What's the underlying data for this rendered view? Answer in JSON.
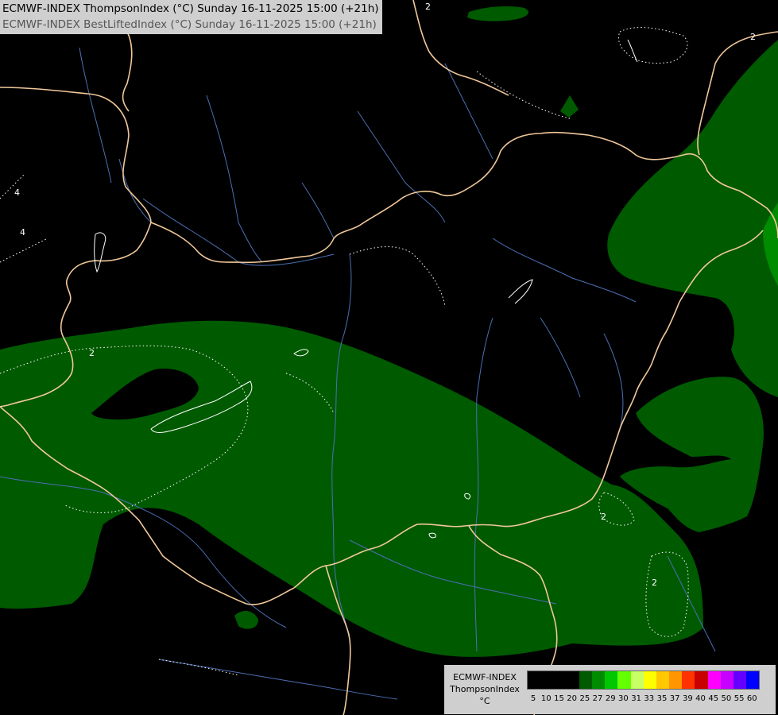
{
  "header": {
    "line1": "ECMWF-INDEX ThompsonIndex (°C) Sunday 16-11-2025 15:00 (+21h)",
    "line2": "ECMWF-INDEX BestLiftedIndex (°C) Sunday 16-11-2025 15:00 (+21h)"
  },
  "legend": {
    "title_line1": "ECMWF-INDEX",
    "title_line2": "ThompsonIndex",
    "unit": "°C",
    "swatches": [
      {
        "color": "#000000",
        "label": "5"
      },
      {
        "color": "#000000",
        "label": "10"
      },
      {
        "color": "#000000",
        "label": "15"
      },
      {
        "color": "#000000",
        "label": "20"
      },
      {
        "color": "#005a00",
        "label": "25"
      },
      {
        "color": "#008c00",
        "label": "27"
      },
      {
        "color": "#00c800",
        "label": "29"
      },
      {
        "color": "#64ff00",
        "label": "30"
      },
      {
        "color": "#c8ff64",
        "label": "31"
      },
      {
        "color": "#ffff00",
        "label": "33"
      },
      {
        "color": "#ffc800",
        "label": "35"
      },
      {
        "color": "#ff9600",
        "label": "37"
      },
      {
        "color": "#ff3200",
        "label": "39"
      },
      {
        "color": "#c80000",
        "label": "40"
      },
      {
        "color": "#ff00ff",
        "label": "45"
      },
      {
        "color": "#c800ff",
        "label": "50"
      },
      {
        "color": "#6400ff",
        "label": "55"
      },
      {
        "color": "#0000ff",
        "label": "60"
      }
    ]
  },
  "map": {
    "fill_color": "#005a00",
    "fill_light_color": "#008c00",
    "border_color": "#f0c89a",
    "river_color": "#4c6fb4",
    "contour_color": "#ffffff",
    "contour_labels": [
      "2",
      "2",
      "2",
      "2",
      "4",
      "4",
      "2"
    ]
  }
}
